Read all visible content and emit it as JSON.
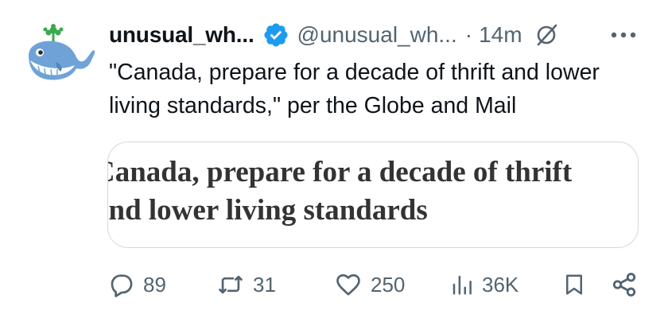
{
  "tweet": {
    "display_name": "unusual_wh...",
    "handle": "@unusual_wh...",
    "separator": "·",
    "time": "14m",
    "text": "\"Canada, prepare for a decade of thrift and lower living standards,\" per the Globe and Mail",
    "card_headline": "Canada, prepare for a decade of thrift\nand lower living standards"
  },
  "icons": {
    "avatar": "whale-avatar-icon",
    "verified": "verified-badge-icon",
    "grok": "grok-icon",
    "more": "more-icon",
    "reply": "reply-icon",
    "retweet": "retweet-icon",
    "like": "like-icon",
    "views": "views-icon",
    "bookmark": "bookmark-icon",
    "share": "share-icon"
  },
  "actions": {
    "replies": "89",
    "retweets": "31",
    "likes": "250",
    "views": "36K"
  },
  "colors": {
    "text": "#0f1419",
    "secondary": "#536471",
    "verified_blue": "#1d9bf0",
    "card_border": "#cfd9de",
    "headline": "#333333"
  }
}
